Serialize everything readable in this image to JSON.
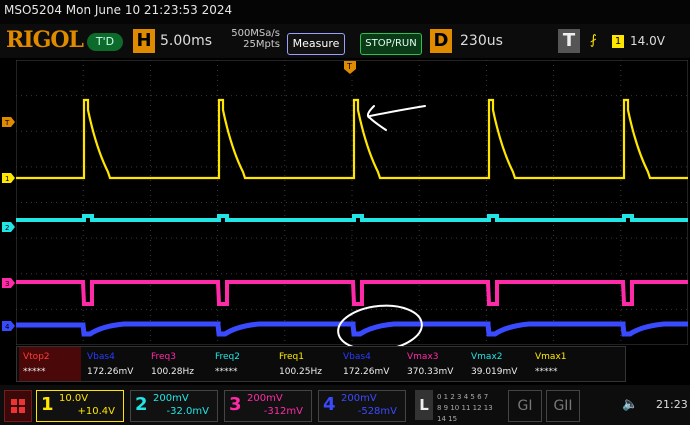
{
  "title": "MSO5204   Mon June 10 21:23:53 2024",
  "logo": "RIGOL",
  "mode": "T'D",
  "horizontal": {
    "label": "H",
    "timebase": "5.00ms",
    "sample_rate": "500MSa/s",
    "memory": "25Mpts"
  },
  "buttons": {
    "measure": "Measure",
    "stop_run": "STOP/RUN"
  },
  "delay": {
    "label": "D",
    "value": "230us"
  },
  "trigger": {
    "label": "T",
    "source": "1",
    "level": "14.0V"
  },
  "markers": {
    "trigger": "T",
    "ch1": "1",
    "ch2": "2",
    "ch3": "3",
    "ch4": "4",
    "top": "T"
  },
  "measurements": [
    {
      "name": "Vtop2",
      "value": "*****",
      "color": "#ff3b3b"
    },
    {
      "name": "Vbas4",
      "value": "172.26mV",
      "color": "#2a3bff"
    },
    {
      "name": "Freq3",
      "value": "100.28Hz",
      "color": "#ff2aa8"
    },
    {
      "name": "Freq2",
      "value": "*****",
      "color": "#22e5e5"
    },
    {
      "name": "Freq1",
      "value": "100.25Hz",
      "color": "#ffea00"
    },
    {
      "name": "Vbas4",
      "value": "172.26mV",
      "color": "#2a3bff"
    },
    {
      "name": "Vmax3",
      "value": "370.33mV",
      "color": "#ff2aa8"
    },
    {
      "name": "Vmax2",
      "value": "39.019mV",
      "color": "#22e5e5"
    },
    {
      "name": "Vmax1",
      "value": "*****",
      "color": "#ffea00"
    }
  ],
  "channels": [
    {
      "num": "1",
      "scale": "10.0V",
      "offset": "+10.4V",
      "color": "#ffe600"
    },
    {
      "num": "2",
      "scale": "200mV",
      "offset": "-32.0mV",
      "color": "#22e5e5"
    },
    {
      "num": "3",
      "scale": "200mV",
      "offset": "-312mV",
      "color": "#ff2aa8"
    },
    {
      "num": "4",
      "scale": "200mV",
      "offset": "-528mV",
      "color": "#3a4bff"
    }
  ],
  "logic": {
    "label": "L",
    "row1": "0 1 2 3 4 5 6 7",
    "row2": "8 9 10 11 12 13 14 15"
  },
  "generators": {
    "g1": "GI",
    "g2": "GII"
  },
  "clock": "21:23",
  "icons": {
    "menu": "menu-grid-icon",
    "speaker": "speaker-icon",
    "trigger_edge": "rising-edge-icon"
  }
}
